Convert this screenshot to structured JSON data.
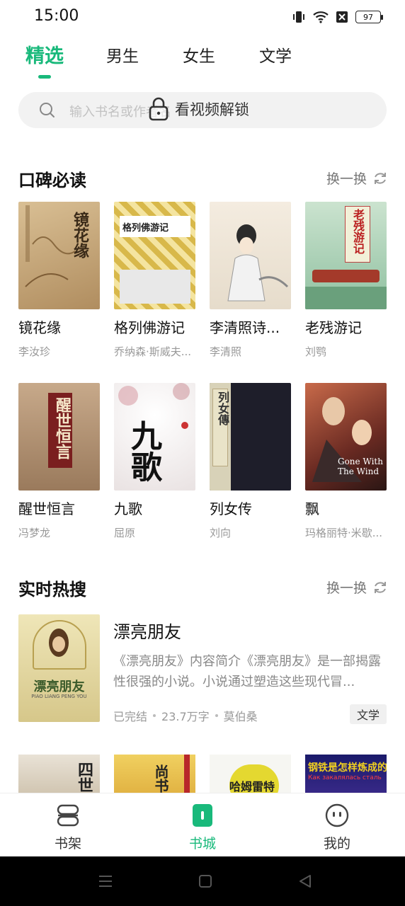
{
  "status": {
    "time": "15:00",
    "battery": "97"
  },
  "tabs": [
    {
      "label": "精选",
      "active": true
    },
    {
      "label": "男生"
    },
    {
      "label": "女生"
    },
    {
      "label": "文学"
    }
  ],
  "search": {
    "placeholder": "输入书名或作者名",
    "unlock_text": "看视频解锁"
  },
  "section1": {
    "title": "口碑必读",
    "refresh": "换一换"
  },
  "books": [
    {
      "title": "镜花缘",
      "author": "李汝珍",
      "cover_text": "镜花缘"
    },
    {
      "title": "格列佛游记",
      "author": "乔纳森·斯威夫...",
      "cover_text": "格列佛游记"
    },
    {
      "title": "李清照诗...",
      "author": "李清照",
      "cover_text": ""
    },
    {
      "title": "老残游记",
      "author": "刘鹗",
      "cover_text": "老残游记"
    },
    {
      "title": "醒世恒言",
      "author": "冯梦龙",
      "cover_text": "醒世恒言"
    },
    {
      "title": "九歌",
      "author": "屈原",
      "cover_text": "九歌"
    },
    {
      "title": "列女传",
      "author": "刘向",
      "cover_text": "列女傳"
    },
    {
      "title": "飘",
      "author": "玛格丽特·米歇...",
      "cover_text": "Gone With The Wind"
    }
  ],
  "section2": {
    "title": "实时热搜",
    "refresh": "换一换"
  },
  "hot": {
    "title": "漂亮朋友",
    "cover_text": "漂亮朋友",
    "cover_subtext": "PIAO LIANG PENG YOU",
    "description": "《漂亮朋友》内容简介《漂亮朋友》是一部揭露性很强的小说。小说通过塑造这些现代冒...",
    "status": "已完结",
    "word_count": "23.7万字",
    "author": "莫伯桑",
    "tag": "文学"
  },
  "peek_books": [
    {
      "cover_text": "四世"
    },
    {
      "cover_text": "尚书"
    },
    {
      "cover_text": "哈姆雷特"
    },
    {
      "cover_text": "钢铁是怎样炼成的",
      "cover_subtext": "Как закалялась сталь"
    }
  ],
  "bottom_nav": [
    {
      "label": "书架",
      "icon": "bookshelf-icon"
    },
    {
      "label": "书城",
      "icon": "bookstore-icon",
      "active": true
    },
    {
      "label": "我的",
      "icon": "profile-icon"
    }
  ],
  "colors": {
    "accent": "#19b97b"
  }
}
